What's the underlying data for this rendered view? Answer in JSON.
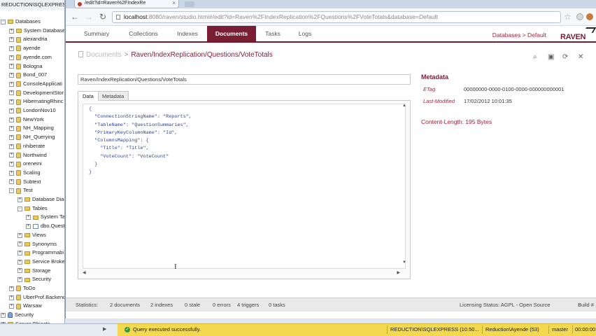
{
  "explorer": {
    "server": "REDUCTION\\SQLEXPRESS",
    "items": [
      {
        "label": "Databases",
        "kind": "folder",
        "indent": 0,
        "exp": "-"
      },
      {
        "label": "System Databases",
        "kind": "folder",
        "indent": 1,
        "exp": "+"
      },
      {
        "label": "alexandria",
        "kind": "db",
        "indent": 1,
        "exp": "+"
      },
      {
        "label": "ayende",
        "kind": "db",
        "indent": 1,
        "exp": "+"
      },
      {
        "label": "ayende.com",
        "kind": "db",
        "indent": 1,
        "exp": "+"
      },
      {
        "label": "Bologna",
        "kind": "db",
        "indent": 1,
        "exp": "+"
      },
      {
        "label": "Bond_007",
        "kind": "db",
        "indent": 1,
        "exp": "+"
      },
      {
        "label": "ConsoleApplicati",
        "kind": "db",
        "indent": 1,
        "exp": "+"
      },
      {
        "label": "DevelopmentStor",
        "kind": "db",
        "indent": 1,
        "exp": "+"
      },
      {
        "label": "HibernatingRhinc",
        "kind": "db",
        "indent": 1,
        "exp": "+"
      },
      {
        "label": "LondonNov10",
        "kind": "db",
        "indent": 1,
        "exp": "+"
      },
      {
        "label": "NewYork",
        "kind": "db",
        "indent": 1,
        "exp": "+"
      },
      {
        "label": "NH_Mapping",
        "kind": "db",
        "indent": 1,
        "exp": "+"
      },
      {
        "label": "NH_Querying",
        "kind": "db",
        "indent": 1,
        "exp": "+"
      },
      {
        "label": "nhiberate",
        "kind": "db",
        "indent": 1,
        "exp": "+"
      },
      {
        "label": "Northwind",
        "kind": "db",
        "indent": 1,
        "exp": "+"
      },
      {
        "label": "oreneini",
        "kind": "db",
        "indent": 1,
        "exp": "+"
      },
      {
        "label": "Scaling",
        "kind": "db",
        "indent": 1,
        "exp": "+"
      },
      {
        "label": "Subtext",
        "kind": "db",
        "indent": 1,
        "exp": "+"
      },
      {
        "label": "Test",
        "kind": "db",
        "indent": 1,
        "exp": "-"
      },
      {
        "label": "Database Diag",
        "kind": "folder",
        "indent": 2,
        "exp": "+"
      },
      {
        "label": "Tables",
        "kind": "folder",
        "indent": 2,
        "exp": "-"
      },
      {
        "label": "System Ta",
        "kind": "folder",
        "indent": 3,
        "exp": "+"
      },
      {
        "label": "dbo.Quest",
        "kind": "table",
        "indent": 3,
        "exp": "+"
      },
      {
        "label": "Views",
        "kind": "folder",
        "indent": 2,
        "exp": "+"
      },
      {
        "label": "Synonyms",
        "kind": "folder",
        "indent": 2,
        "exp": "+"
      },
      {
        "label": "Programmabi",
        "kind": "folder",
        "indent": 2,
        "exp": "+"
      },
      {
        "label": "Service Broker",
        "kind": "folder",
        "indent": 2,
        "exp": "+"
      },
      {
        "label": "Storage",
        "kind": "folder",
        "indent": 2,
        "exp": "+"
      },
      {
        "label": "Security",
        "kind": "folder",
        "indent": 2,
        "exp": "+"
      },
      {
        "label": "ToDo",
        "kind": "db",
        "indent": 1,
        "exp": "+"
      },
      {
        "label": "UberProf.Backend",
        "kind": "db",
        "indent": 1,
        "exp": "+"
      },
      {
        "label": "Warsaw",
        "kind": "db",
        "indent": 1,
        "exp": "+"
      },
      {
        "label": "Security",
        "kind": "sec",
        "indent": 0,
        "exp": "+"
      },
      {
        "label": "Server Objects",
        "kind": "folder",
        "indent": 0,
        "exp": "+"
      }
    ]
  },
  "browser": {
    "tab_title": "/edit?id=Raven%2FIndexRe",
    "url_host": "localhost",
    "url_rest": ":8080/raven/studio.html#/edit?id=Raven%2FIndexReplication%2FQuestions%2FVoteTotals&database=Default",
    "icons": [
      "back-icon",
      "forward-icon",
      "reload-icon",
      "star-icon"
    ]
  },
  "studio": {
    "nav": [
      "Summary",
      "Collections",
      "Indexes",
      "Documents",
      "Tasks",
      "Logs"
    ],
    "active_nav": "Documents",
    "databases_link": "Databases > Default",
    "logo": "RAVEN",
    "breadcrumb": {
      "documents": "Documents",
      "separator": ">",
      "current": "Raven/IndexReplication/Questions/VoteTotals"
    },
    "document_id": "Raven/IndexReplication/Questions/VoteTotals",
    "tabs": {
      "data": "Data",
      "metadata": "Metadata"
    },
    "json_lines": [
      "{",
      "  \"ConnectionStringName\": \"Reports\",",
      "  \"TableName\": \"QuestionSummaries\",",
      "  \"PrimaryKeyColumnName\": \"Id\",",
      "  \"ColumnsMapping\": {",
      "    \"Title\": \"Title\",",
      "    \"VoteCount\": \"VoteCount\"",
      "  }",
      "}"
    ],
    "metadata": {
      "title": "Metadata",
      "etag_label": "ETag",
      "etag_value": "00000000-0000-0100-0000-000000000001",
      "modified_label": "Last-Modified",
      "modified_value": "17/02/2012 10:01:35",
      "content_length": "Content-Length: 195 Bytes"
    },
    "statusbar": {
      "statistics": "Statistics:",
      "documents": "2 documents",
      "indexes": "2 indexes",
      "stale": "0 stale",
      "errors": "0 errors",
      "triggers": "4 triggers",
      "tasks": "0 tasks",
      "licensing": "Licensing Status:  AGPL - Open Source",
      "build": "Build #"
    }
  },
  "ssms_status": {
    "message": "Query executed successfully.",
    "server": "REDUCTION\\SQLEXPRESS (10.50...",
    "user": "Reduction\\Ayende (53)",
    "database": "master",
    "time": "00:00:00"
  },
  "colors": {
    "accent": "#7a1f33",
    "status_yellow": "#f2d94f"
  }
}
